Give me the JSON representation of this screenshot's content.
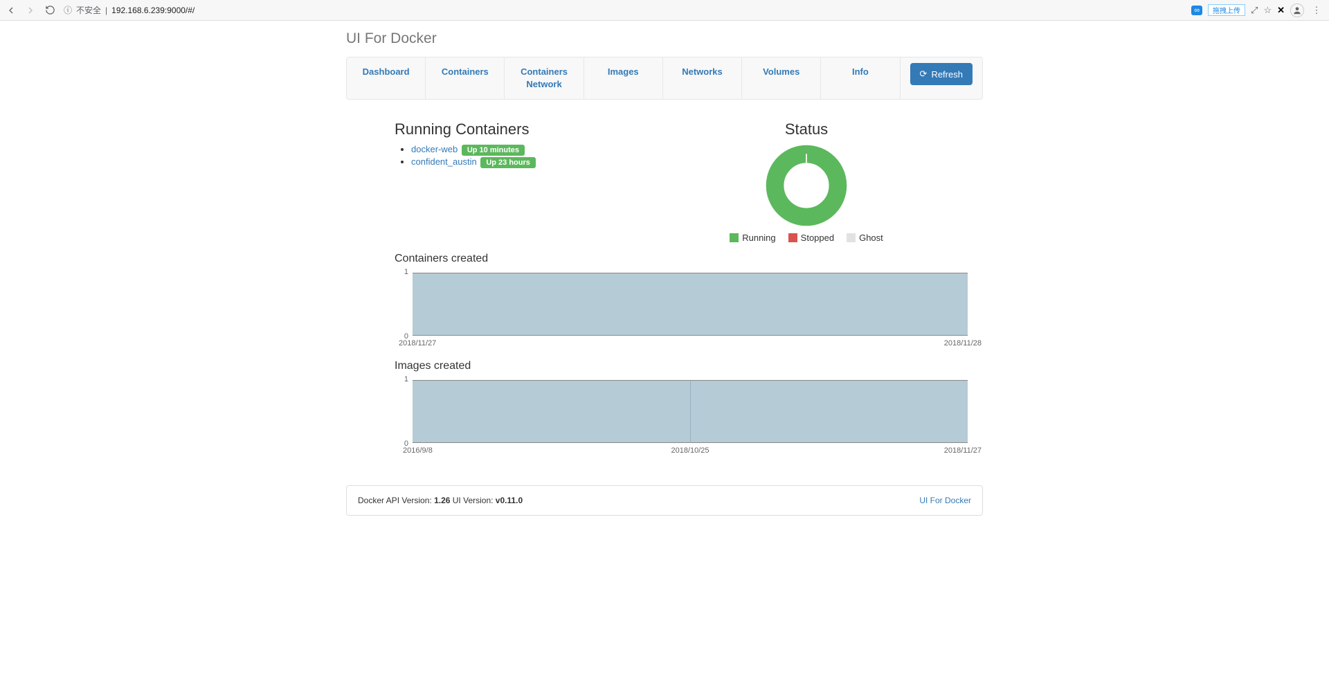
{
  "browser": {
    "insecure_label": "不安全",
    "url": "192.168.6.239:9000/#/",
    "ext_tip": "拖拽上传"
  },
  "title": "UI For Docker",
  "nav": {
    "dashboard": "Dashboard",
    "containers": "Containers",
    "containers_network": "Containers Network",
    "images": "Images",
    "networks": "Networks",
    "volumes": "Volumes",
    "info": "Info",
    "refresh": "Refresh"
  },
  "running": {
    "heading": "Running Containers",
    "items": [
      {
        "name": "docker-web",
        "status": "Up 10 minutes"
      },
      {
        "name": "confident_austin",
        "status": "Up 23 hours"
      }
    ]
  },
  "status": {
    "heading": "Status",
    "legend": {
      "running": "Running",
      "stopped": "Stopped",
      "ghost": "Ghost"
    },
    "colors": {
      "running": "#5cb85c",
      "stopped": "#d9534f",
      "ghost": "#e2e2e2"
    }
  },
  "chart_data": [
    {
      "type": "area",
      "title": "Containers created",
      "x": [
        "2018/11/27",
        "2018/11/28"
      ],
      "values": [
        1,
        1
      ],
      "ylim": [
        0,
        1
      ],
      "yticks": [
        0,
        1
      ]
    },
    {
      "type": "area",
      "title": "Images created",
      "x": [
        "2016/9/8",
        "2018/10/25",
        "2018/11/27"
      ],
      "values": [
        1,
        1,
        1
      ],
      "ylim": [
        0,
        1
      ],
      "yticks": [
        0,
        1
      ]
    }
  ],
  "footer": {
    "api_label": "Docker API Version: ",
    "api_version": "1.26",
    "ui_label": " UI Version: ",
    "ui_version": "v0.11.0",
    "link": "UI For Docker"
  }
}
